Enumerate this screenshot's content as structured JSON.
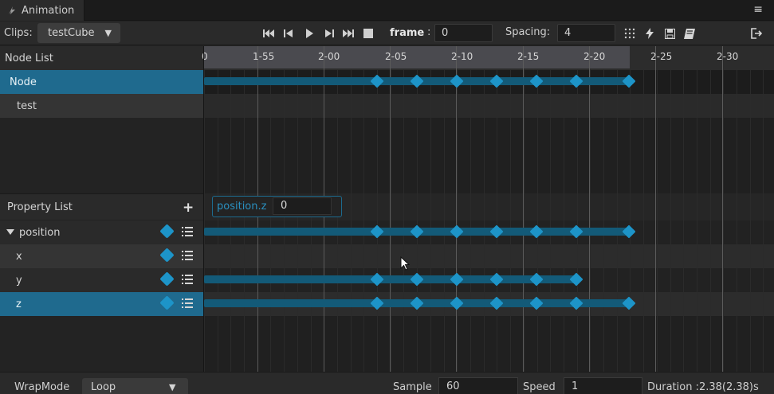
{
  "window": {
    "tab_title": "Animation"
  },
  "toolbar": {
    "clips_label": "Clips:",
    "clip_selected": "testCube",
    "frame_label": "frame",
    "frame_colon": ":",
    "frame_value": "0",
    "spacing_label": "Spacing:",
    "spacing_value": "4"
  },
  "node_list": {
    "header": "Node List",
    "items": [
      {
        "label": "Node",
        "selected": true
      },
      {
        "label": "test",
        "selected": false
      }
    ]
  },
  "property_list": {
    "header": "Property List",
    "add_symbol": "+",
    "items": [
      {
        "label": "position",
        "expanded": true
      },
      {
        "label": "x"
      },
      {
        "label": "y"
      },
      {
        "label": "z",
        "selected": true
      }
    ]
  },
  "property_editor": {
    "label": "position.z",
    "value": "0"
  },
  "ruler": {
    "ticks": [
      "0",
      "1-55",
      "2-00",
      "2-05",
      "2-10",
      "2-15",
      "2-20",
      "2-25",
      "2-30"
    ]
  },
  "bottom": {
    "wrap_label": "WrapMode",
    "wrap_value": "Loop",
    "sample_label": "Sample",
    "sample_value": "60",
    "speed_label": "Speed",
    "speed_value": "1",
    "duration_text": "Duration :2.38(2.38)s"
  },
  "colors": {
    "accent": "#1d94c8",
    "selection": "#1f6a8e",
    "track": "#135a78"
  },
  "icons": [
    "animation-icon",
    "menu-icon",
    "first-frame-icon",
    "prev-frame-icon",
    "play-icon",
    "next-frame-icon",
    "last-frame-icon",
    "stop-icon",
    "grid-icon",
    "event-icon",
    "save-icon",
    "book-icon",
    "exit-icon",
    "keyframe-icon",
    "list-icon",
    "collapse-arrow-icon",
    "cursor-icon"
  ]
}
